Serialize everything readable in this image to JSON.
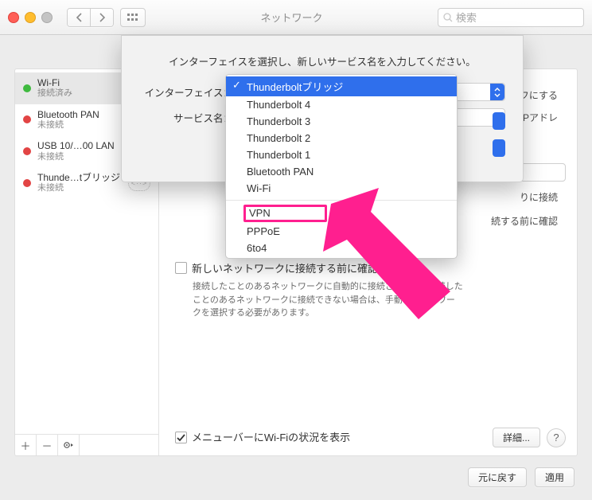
{
  "window": {
    "title": "ネットワーク",
    "search_placeholder": "検索"
  },
  "sidebar": {
    "items": [
      {
        "name": "Wi-Fi",
        "status": "接続済み",
        "dot": "green",
        "knob": false
      },
      {
        "name": "Bluetooth PAN",
        "status": "未接続",
        "dot": "red",
        "knob": false
      },
      {
        "name": "USB 10/…00 LAN",
        "status": "未接続",
        "dot": "red",
        "knob": true
      },
      {
        "name": "Thunde…tブリッジ",
        "status": "未接続",
        "dot": "red",
        "knob": true
      }
    ]
  },
  "detail": {
    "bg_off_label": "フにする",
    "bg_ip_hint": "て、IPアドレ",
    "bg_auto_connect": "りに接続",
    "bg_confirm_before": "続する前に確認",
    "check_new_label": "新しいネットワークに接続する前に確認",
    "check_new_note": "接続したことのあるネットワークに自動的に接続されます。接続したことのあるネットワークに接続できない場合は、手動でネットワークを選択する必要があります。",
    "show_in_menubar": "メニューバーにWi-Fiの状況を表示",
    "details_btn": "詳細...",
    "revert_btn": "元に戻す",
    "apply_btn": "適用"
  },
  "sheet": {
    "prompt": "インターフェイスを選択し、新しいサービス名を入力してください。",
    "label_interface": "インターフェイス：",
    "label_service": "サービス名："
  },
  "dropdown": {
    "items": [
      {
        "label": "Thunderboltブリッジ",
        "selected": true
      },
      {
        "label": "Thunderbolt 4"
      },
      {
        "label": "Thunderbolt 3"
      },
      {
        "label": "Thunderbolt 2"
      },
      {
        "label": "Thunderbolt 1"
      },
      {
        "label": "Bluetooth PAN"
      },
      {
        "label": "Wi-Fi"
      },
      {
        "separator": true
      },
      {
        "label": "VPN",
        "highlight": true
      },
      {
        "label": "PPPoE"
      },
      {
        "label": "6to4"
      }
    ]
  }
}
